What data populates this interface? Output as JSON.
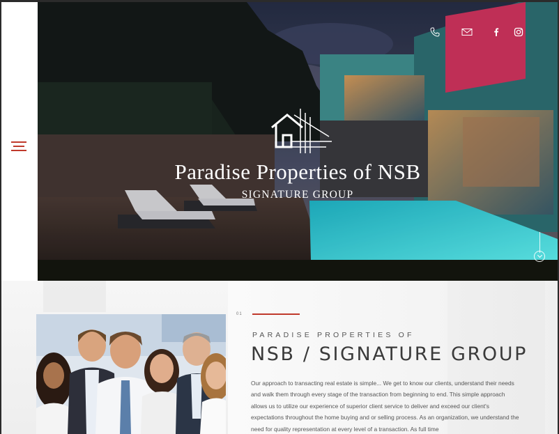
{
  "brand": {
    "title": "Paradise Properties of NSB",
    "subtitle": "SIGNATURE GROUP"
  },
  "nav": {
    "menu_icon": "hamburger-menu-icon"
  },
  "social": [
    {
      "name": "phone-icon"
    },
    {
      "name": "mail-icon"
    },
    {
      "name": "facebook-icon"
    },
    {
      "name": "instagram-icon"
    }
  ],
  "about": {
    "section_number": "01",
    "kicker": "Paradise Properties of",
    "headline": "NSB / SIGNATURE GROUP",
    "body": "Our approach to transacting real estate is simple... We get to know our clients, understand their needs and walk them through every stage of the transaction from beginning to end. This simple approach allows us to utilize our experience of superior client service to deliver and exceed our client's expectations throughout the home buying and or selling process. As an organization, we understand the need for quality representation at every level of a transaction. As full time"
  },
  "colors": {
    "accent": "#c0392b",
    "hero_dark": "#2a3148",
    "pool": "#2fd0d8",
    "text": "#555555"
  }
}
